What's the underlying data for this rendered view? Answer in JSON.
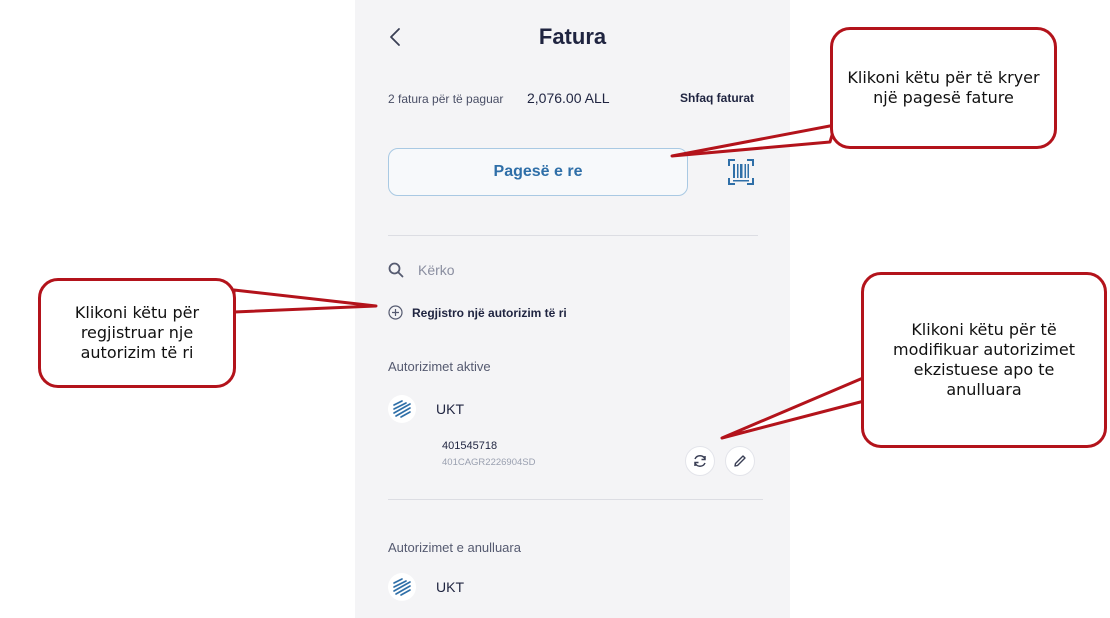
{
  "header": {
    "title": "Fatura"
  },
  "summary": {
    "count_text": "2 fatura për të paguar",
    "amount": "2,076.00 ALL",
    "show_link": "Shfaq faturat"
  },
  "actions": {
    "new_payment_label": "Pagesë e re"
  },
  "search": {
    "placeholder": "Kërko"
  },
  "register": {
    "label": "Regjistro një autorizim të ri"
  },
  "active": {
    "section_title": "Autorizimet aktive",
    "items": [
      {
        "provider": "UKT",
        "number": "401545718",
        "code": "401CAGR2226904SD"
      }
    ]
  },
  "cancelled": {
    "section_title": "Autorizimet e anulluara",
    "items": [
      {
        "provider": "UKT"
      }
    ]
  },
  "callouts": {
    "payment": "Klikoni këtu për të kryer një pagesë fature",
    "register": "Klikoni këtu për regjistruar nje autorizim të ri",
    "modify": "Klikoni këtu për të modifikuar autorizimet ekzistuese apo te anulluara"
  },
  "icons": {
    "back": "chevron-left-icon",
    "barcode": "barcode-scan-icon",
    "search": "search-icon",
    "add": "plus-circle-icon",
    "refresh": "refresh-icon",
    "edit": "pencil-icon",
    "provider_logo": "ukt-logo-icon"
  },
  "colors": {
    "accent_blue": "#2f6fa8",
    "text_dark": "#1f2440",
    "callout_red": "#b3131b"
  }
}
